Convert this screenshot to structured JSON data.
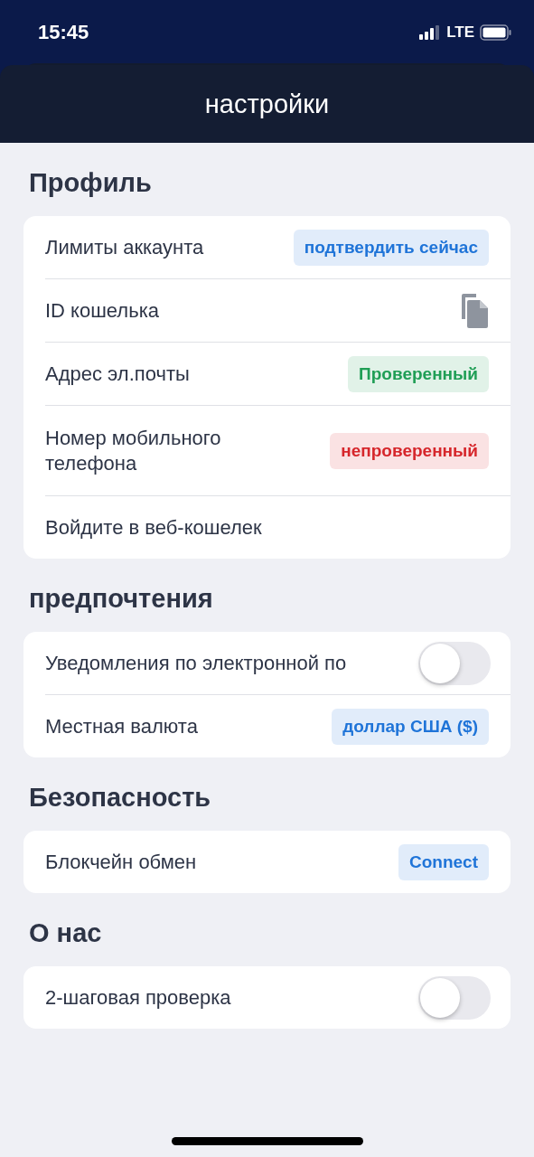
{
  "status_bar": {
    "time": "15:45",
    "network": "LTE"
  },
  "header": {
    "title": "настройки"
  },
  "sections": [
    {
      "title": "Профиль",
      "rows": [
        {
          "kind": "badge",
          "label": "Лимиты аккаунта",
          "badge": "подтвердить сейчас",
          "color": "#1f74d8"
        },
        {
          "kind": "copy",
          "label": "ID кошелька"
        },
        {
          "kind": "badge",
          "label": "Адрес эл.почты",
          "badge": "Проверенный",
          "color": "#1f9e55"
        },
        {
          "kind": "badge",
          "label": "Номер мобильного телефона",
          "badge": "непроверенный",
          "color": "#d6262b"
        },
        {
          "kind": "plain",
          "label": "Войдите в веб-кошелек"
        }
      ]
    },
    {
      "title": "предпочтения",
      "rows": [
        {
          "kind": "toggle",
          "label": "Уведомления по электронной по",
          "on": false
        },
        {
          "kind": "badge",
          "label": "Местная валюта",
          "badge": "доллар США ($)",
          "color": "#1f74d8"
        }
      ]
    },
    {
      "title": "Безопасность",
      "rows": [
        {
          "kind": "badge",
          "label": "Блокчейн обмен",
          "badge": "Connect",
          "color": "#1f74d8"
        }
      ]
    },
    {
      "title": "О нас",
      "rows": [
        {
          "kind": "toggle",
          "label": "2-шаговая проверка",
          "on": false
        }
      ]
    }
  ]
}
